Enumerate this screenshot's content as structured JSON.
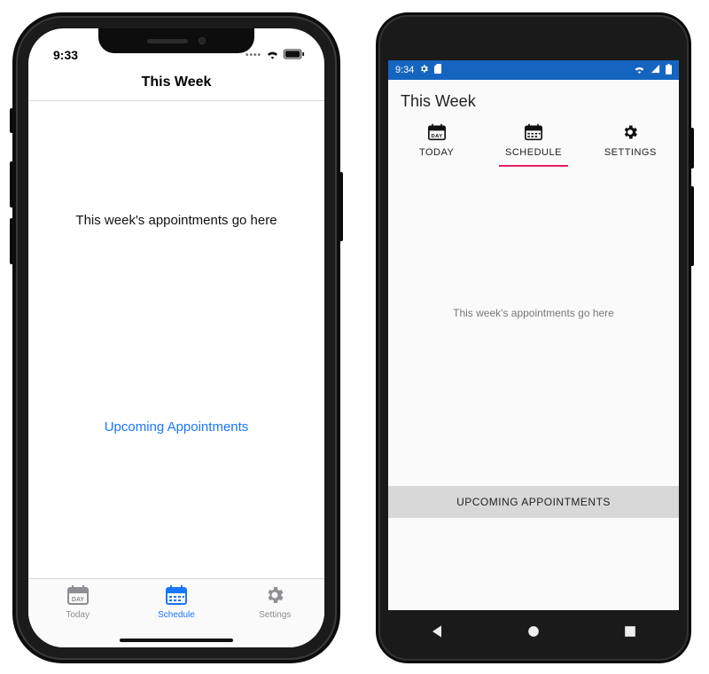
{
  "ios": {
    "status": {
      "time": "9:33"
    },
    "navbar": {
      "title": "This Week"
    },
    "body": {
      "placeholder": "This week's appointments go here"
    },
    "upcoming": {
      "label": "Upcoming Appointments"
    },
    "tabs": [
      {
        "label": "Today",
        "icon": "calendar-day-icon",
        "active": false
      },
      {
        "label": "Schedule",
        "icon": "calendar-week-icon",
        "active": true
      },
      {
        "label": "Settings",
        "icon": "gear-icon",
        "active": false
      }
    ],
    "accent_color": "#1976ff"
  },
  "android": {
    "status": {
      "time": "9:34"
    },
    "title": "This Week",
    "body": {
      "placeholder": "This week's appointments go here"
    },
    "upcoming": {
      "label": "UPCOMING APPOINTMENTS"
    },
    "tabs": [
      {
        "label": "TODAY",
        "icon": "calendar-day-icon",
        "active": false
      },
      {
        "label": "SCHEDULE",
        "icon": "calendar-week-icon",
        "active": true
      },
      {
        "label": "SETTINGS",
        "icon": "gear-icon",
        "active": false
      }
    ],
    "statusbar_color": "#1565c0",
    "tab_indicator_color": "#e91e63"
  }
}
